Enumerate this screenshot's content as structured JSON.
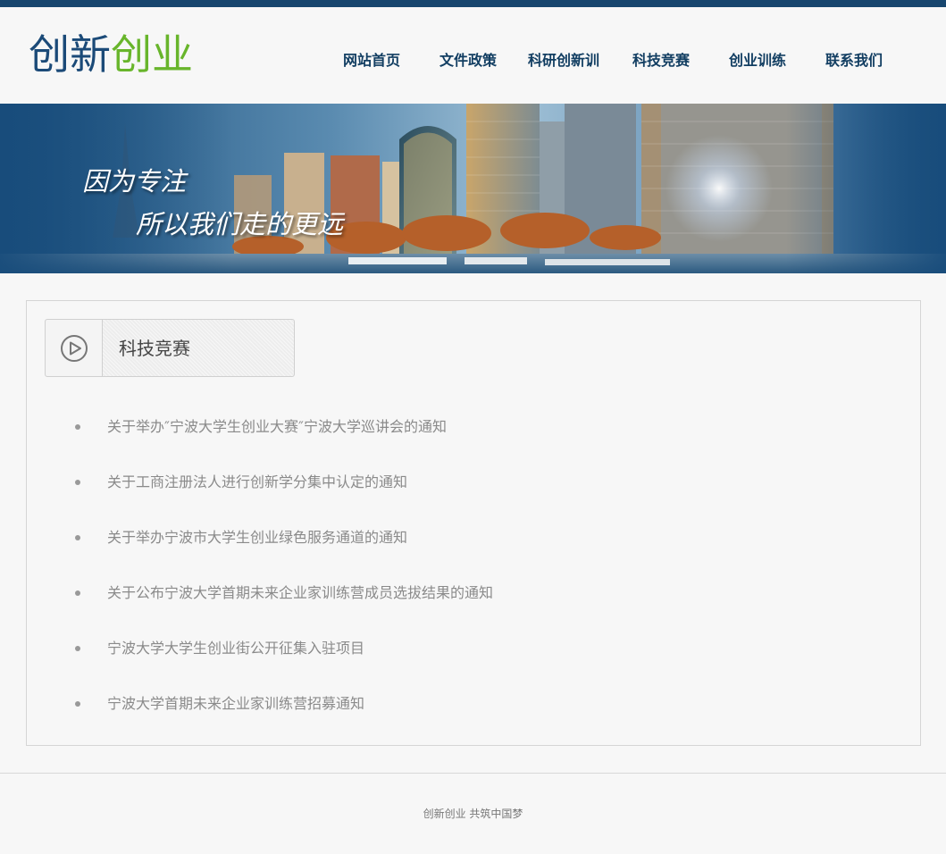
{
  "header": {
    "logo_part1": "创新",
    "logo_part2": "创业",
    "nav": [
      {
        "label": "网站首页"
      },
      {
        "label": "文件政策"
      },
      {
        "label": "科研创新训"
      },
      {
        "label": "科技竞赛"
      },
      {
        "label": "创业训练"
      },
      {
        "label": "联系我们"
      }
    ]
  },
  "banner": {
    "slogan_line1": "因为专注",
    "slogan_line2": "所以我们走的更远"
  },
  "section": {
    "title": "科技竞赛",
    "icon": "play-circle-icon",
    "items": [
      {
        "title": "关于举办″宁波大学生创业大赛″宁波大学巡讲会的通知"
      },
      {
        "title": "关于工商注册法人进行创新学分集中认定的通知"
      },
      {
        "title": "关于举办宁波市大学生创业绿色服务通道的通知"
      },
      {
        "title": "关于公布宁波大学首期未来企业家训练营成员选拔结果的通知"
      },
      {
        "title": "宁波大学大学生创业街公开征集入驻项目"
      },
      {
        "title": "宁波大学首期未来企业家训练营招募通知"
      }
    ]
  },
  "footer": {
    "text": "创新创业 共筑中国梦"
  },
  "colors": {
    "topbar": "#17466e",
    "nav_text": "#123e62",
    "logo_blue": "#1b4a78",
    "logo_green": "#68b52b"
  }
}
